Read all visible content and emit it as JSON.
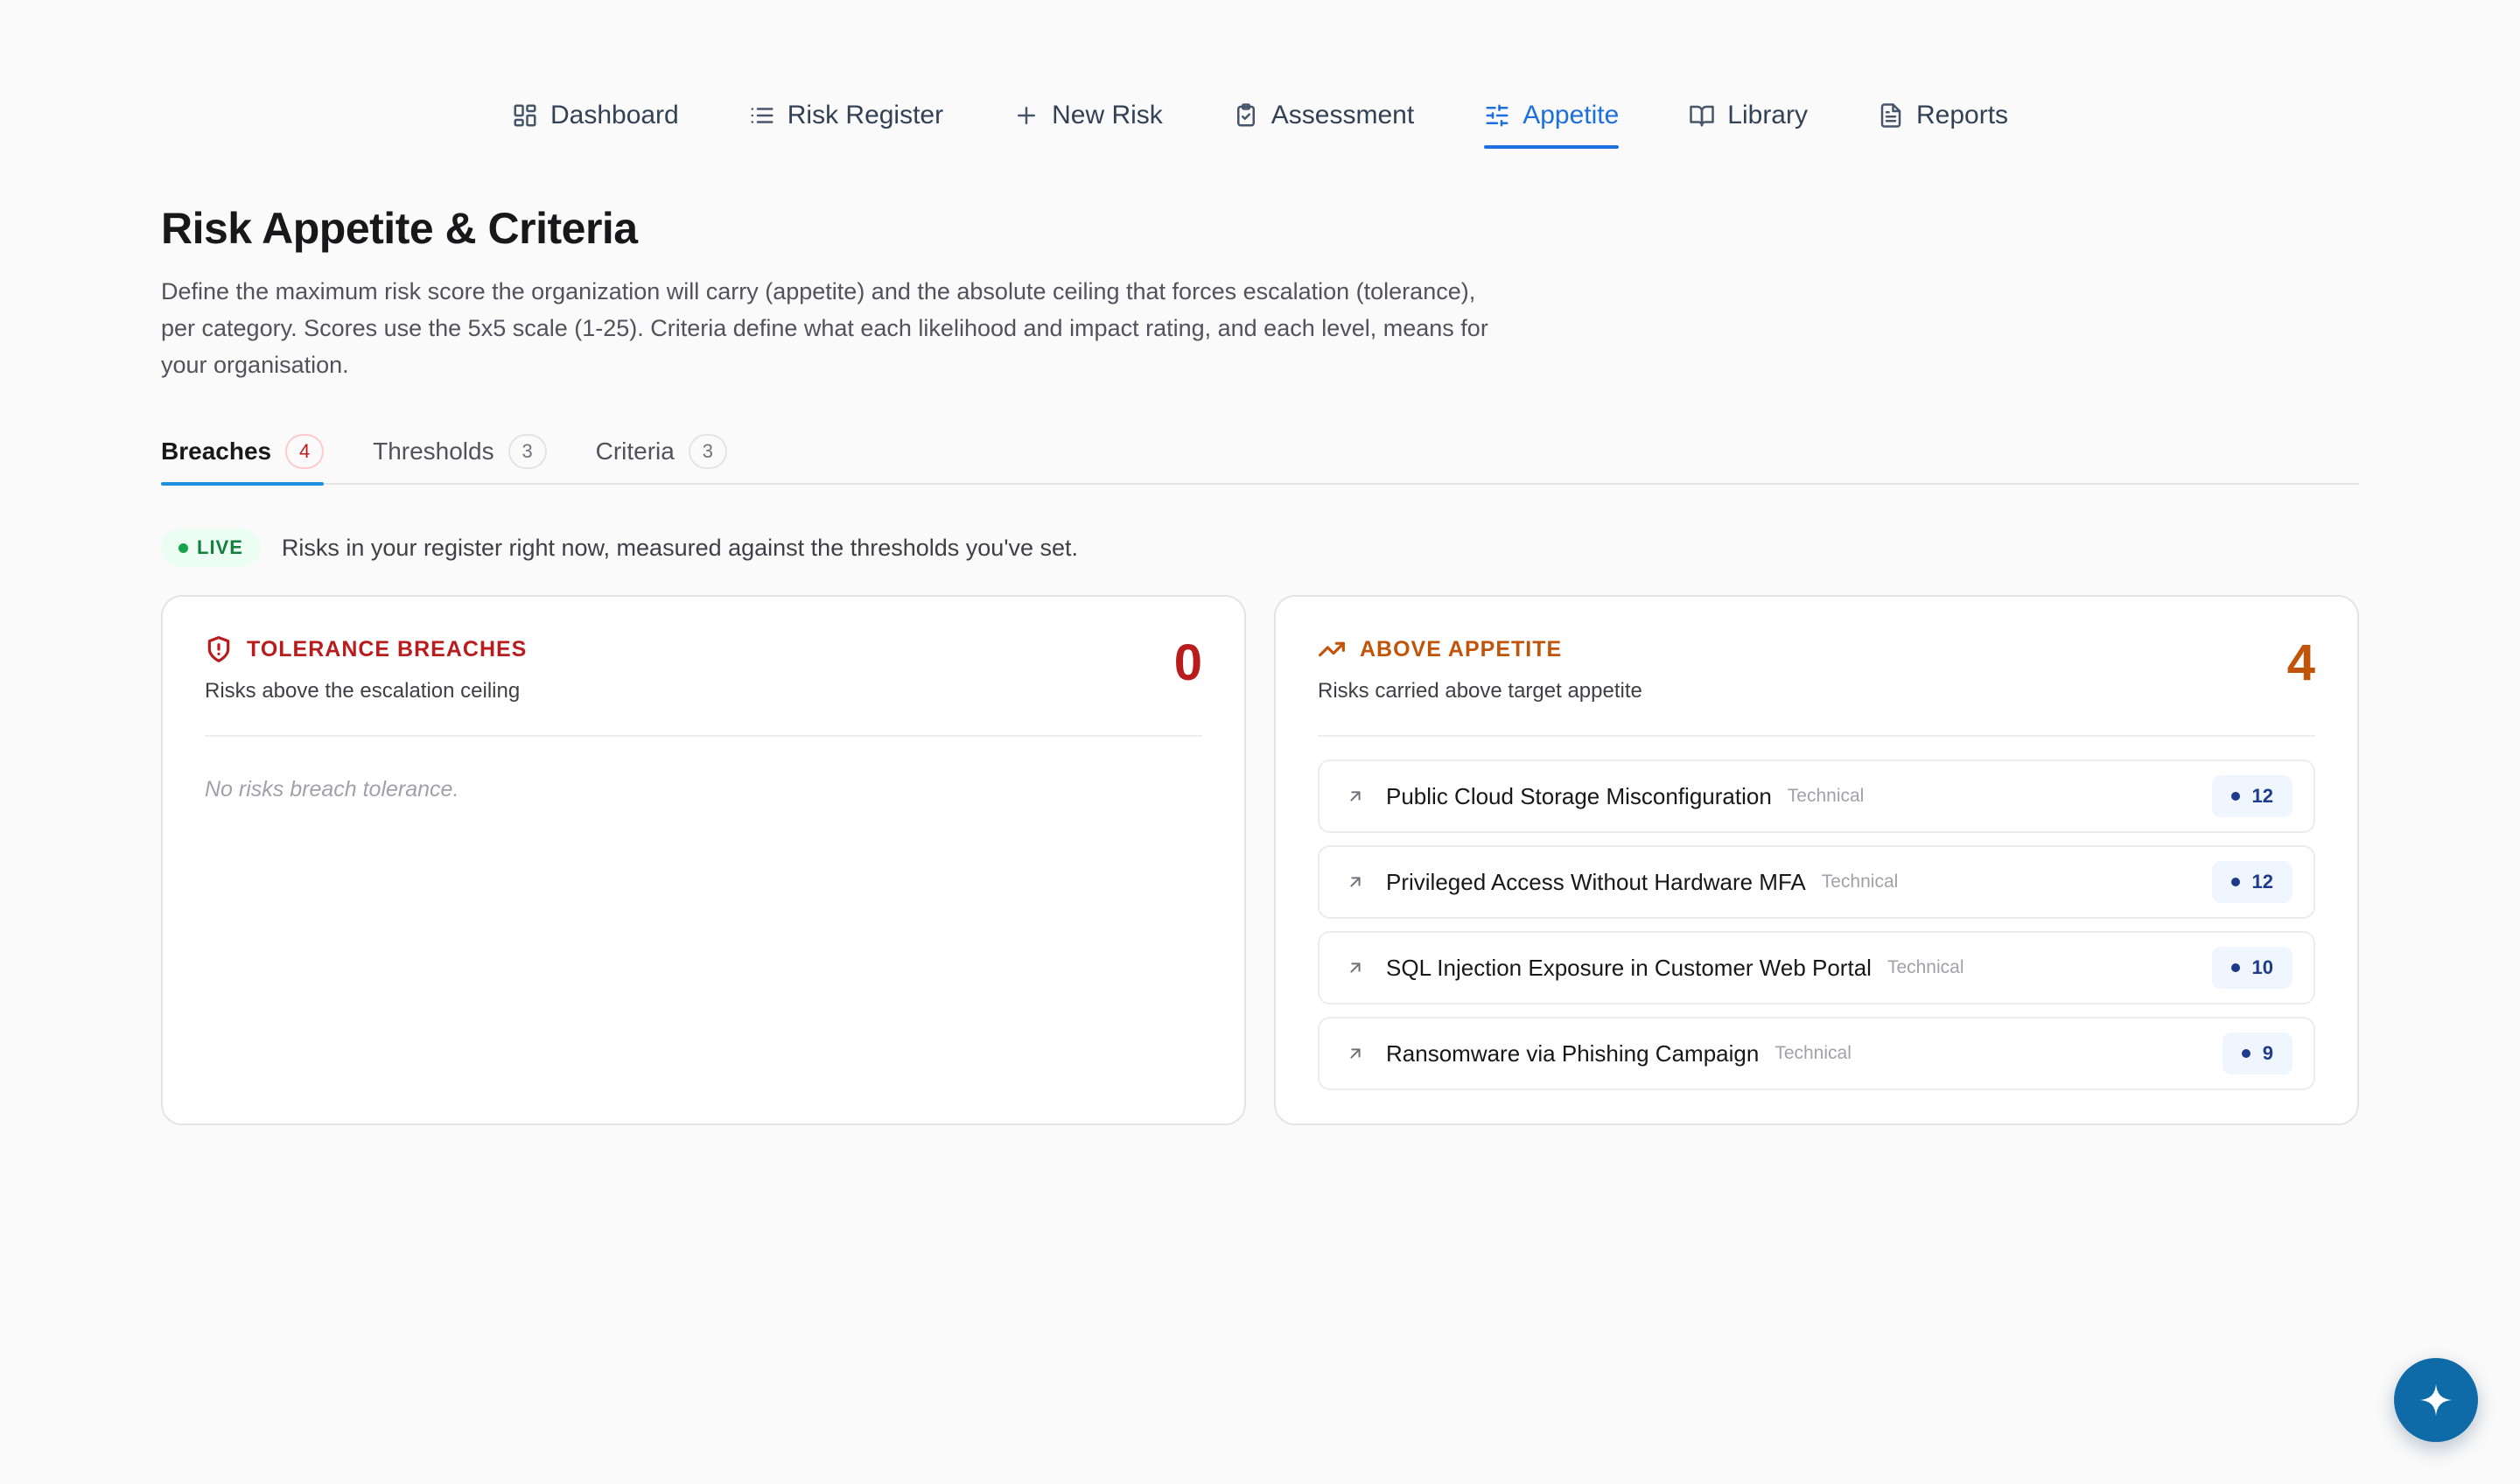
{
  "nav": {
    "items": [
      {
        "label": "Dashboard",
        "icon": "dashboard-icon"
      },
      {
        "label": "Risk Register",
        "icon": "list-icon"
      },
      {
        "label": "New Risk",
        "icon": "plus-icon"
      },
      {
        "label": "Assessment",
        "icon": "clipboard-check-icon"
      },
      {
        "label": "Appetite",
        "icon": "sliders-icon",
        "active": true
      },
      {
        "label": "Library",
        "icon": "book-open-icon"
      },
      {
        "label": "Reports",
        "icon": "file-text-icon"
      }
    ]
  },
  "header": {
    "title": "Risk Appetite & Criteria",
    "description": "Define the maximum risk score the organization will carry (appetite) and the absolute ceiling that forces escalation (tolerance), per category. Scores use the 5x5 scale (1-25). Criteria define what each likelihood and impact rating, and each level, means for your organisation."
  },
  "tabs": [
    {
      "label": "Breaches",
      "count": "4",
      "active": true
    },
    {
      "label": "Thresholds",
      "count": "3"
    },
    {
      "label": "Criteria",
      "count": "3"
    }
  ],
  "live": {
    "badge": "LIVE",
    "text": "Risks in your register right now, measured against the thresholds you've set."
  },
  "tolerance": {
    "label": "TOLERANCE BREACHES",
    "subtitle": "Risks above the escalation ceiling",
    "count": "0",
    "empty": "No risks breach tolerance.",
    "icon": "shield-alert-icon"
  },
  "appetite": {
    "label": "ABOVE APPETITE",
    "subtitle": "Risks carried above target appetite",
    "count": "4",
    "icon": "trending-up-icon",
    "risks": [
      {
        "name": "Public Cloud Storage Misconfiguration",
        "category": "Technical",
        "score": "12"
      },
      {
        "name": "Privileged Access Without Hardware MFA",
        "category": "Technical",
        "score": "12"
      },
      {
        "name": "SQL Injection Exposure in Customer Web Portal",
        "category": "Technical",
        "score": "10"
      },
      {
        "name": "Ransomware via Phishing Campaign",
        "category": "Technical",
        "score": "9"
      }
    ]
  },
  "fab": {
    "icon": "sparkle-plus-icon"
  },
  "colors": {
    "accent": "#1d6fe0",
    "danger": "#b91c1c",
    "warning": "#c2540a",
    "live": "#15803d",
    "fab": "#0f6ba8"
  }
}
